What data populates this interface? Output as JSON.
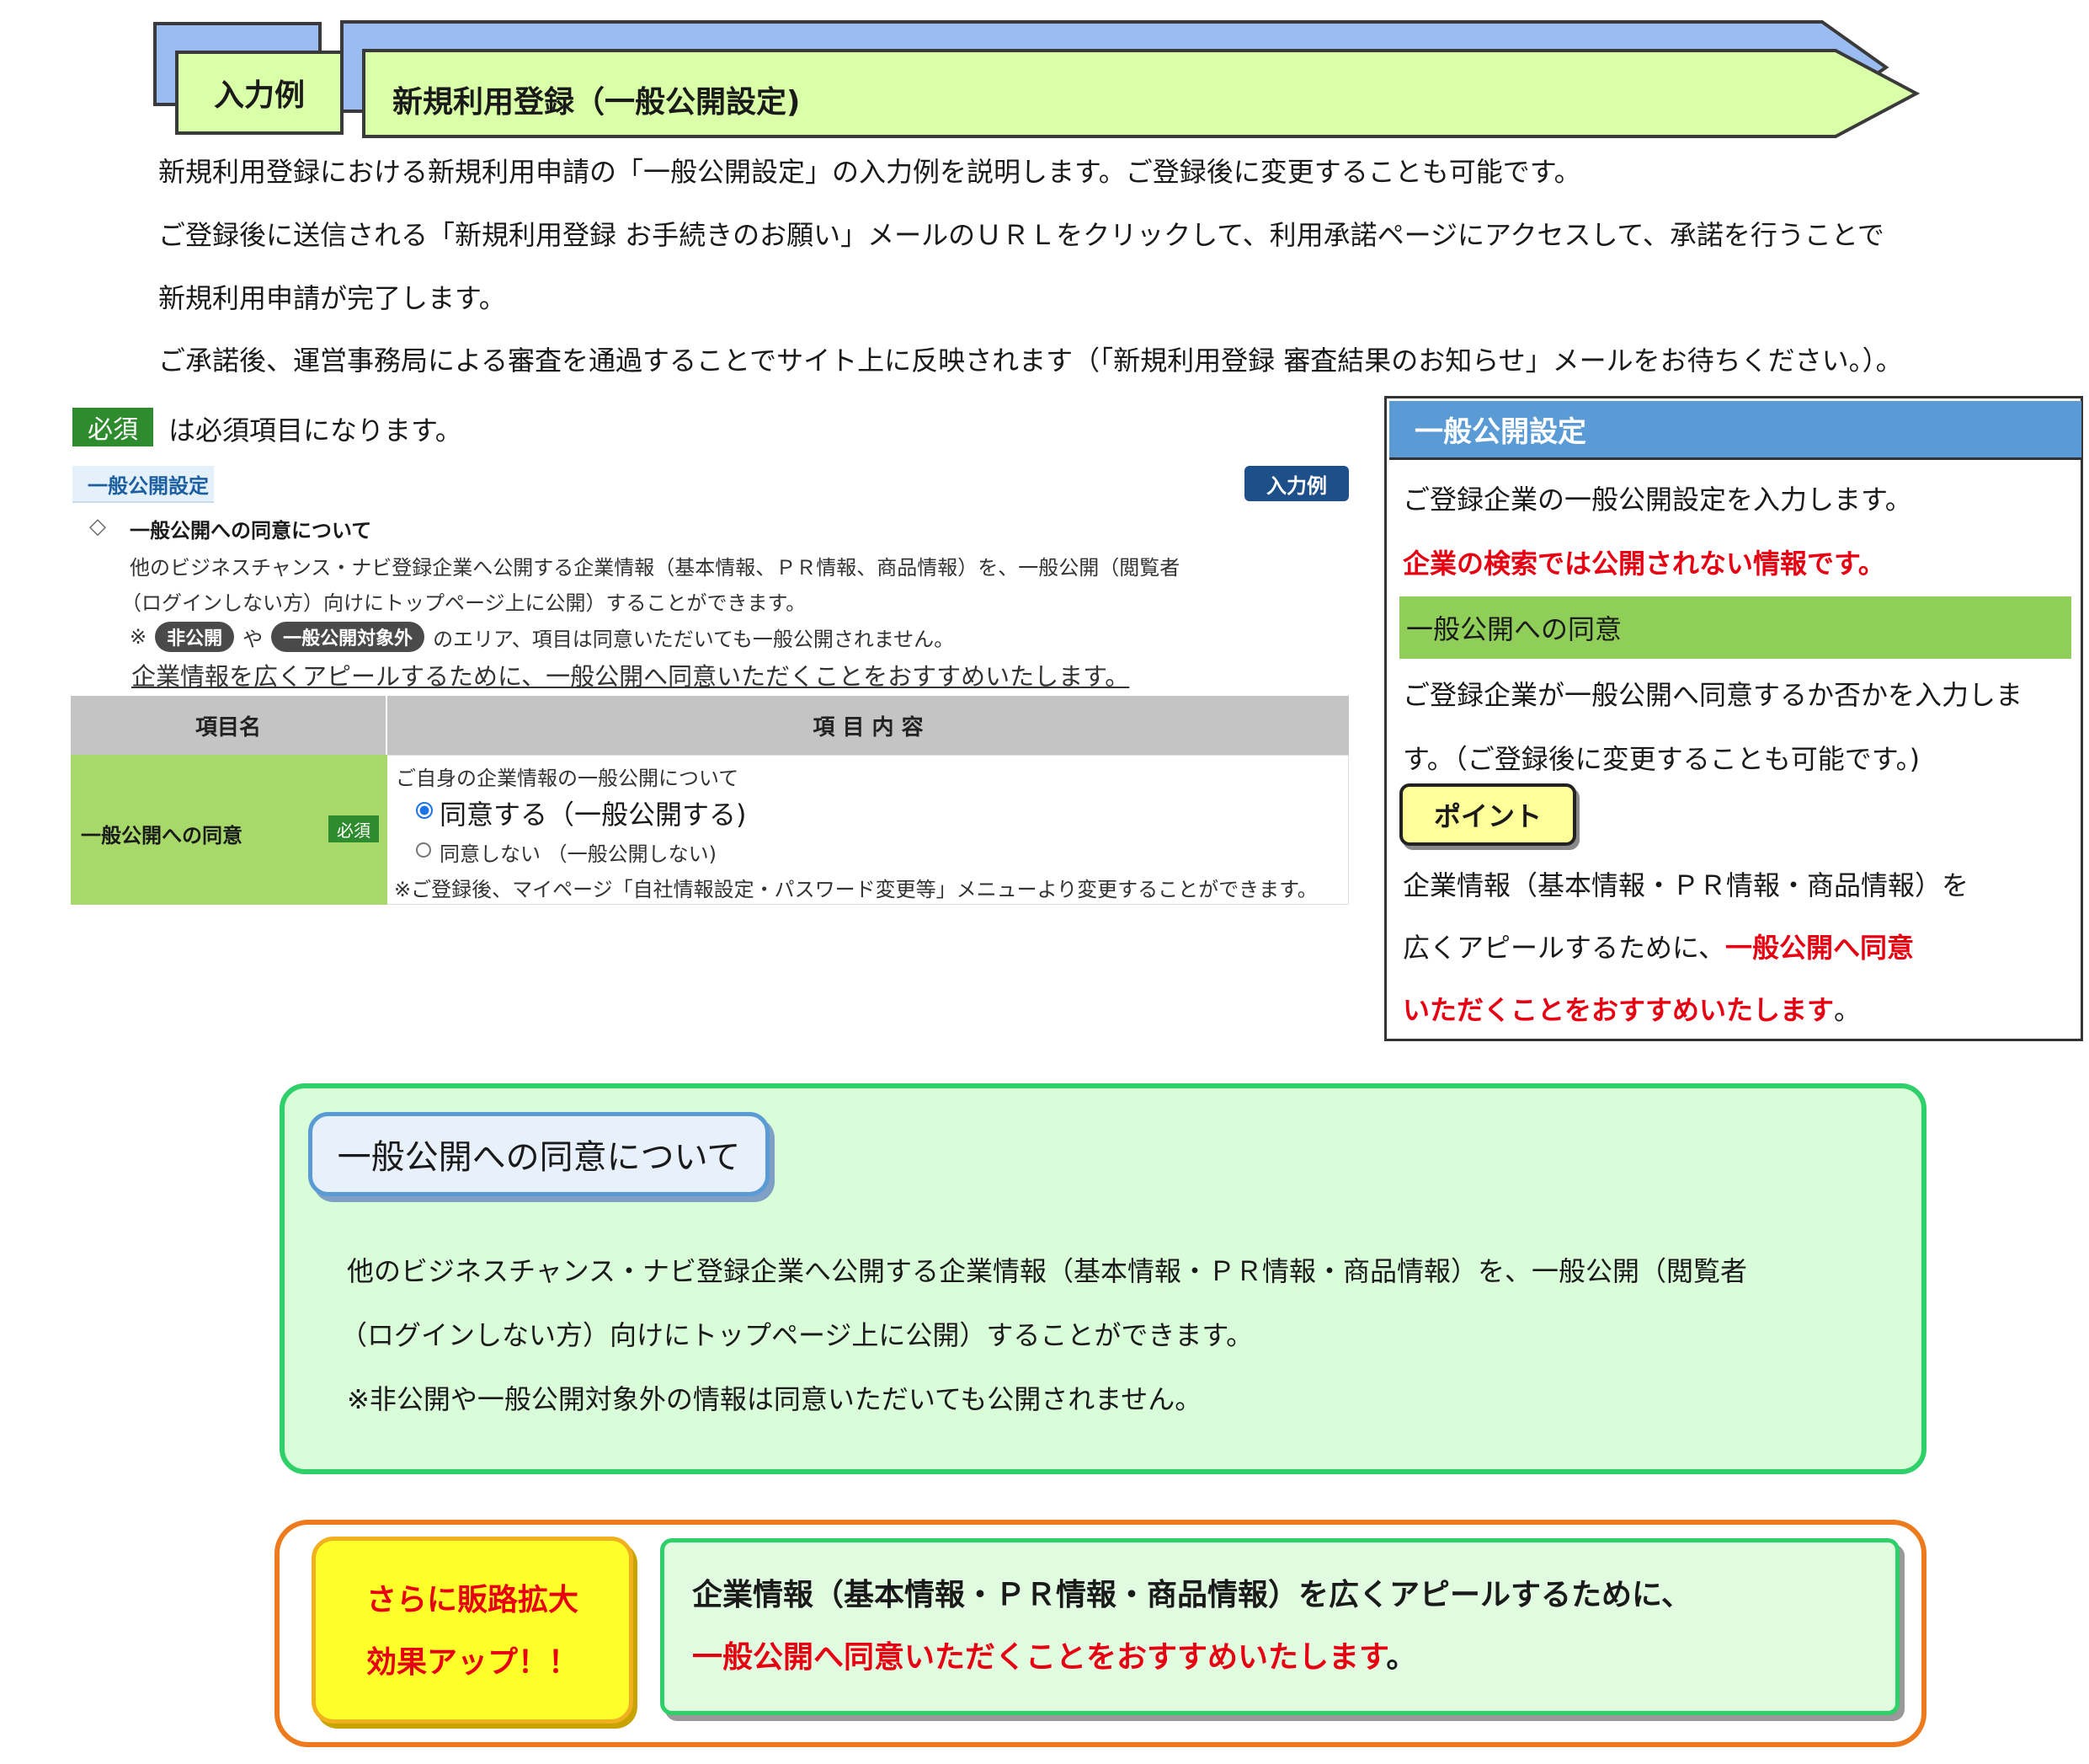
{
  "header": {
    "tag": "入力例",
    "title": "新規利用登録（一般公開設定)"
  },
  "intro": {
    "line1": "新規利用登録における新規利用申請の「一般公開設定」の入力例を説明します。ご登録後に変更することも可能です。",
    "line2": "ご登録後に送信される「新規利用登録 お手続きのお願い」メールのＵＲＬをクリックして、利用承諾ページにアクセスして、承諾を行うことで",
    "line3": "新規利用申請が完了します。",
    "line4": "ご承諾後、運営事務局による審査を通過することでサイト上に反映されます（「新規利用登録 審査結果のお知らせ」メールをお待ちください。）。"
  },
  "required_note": {
    "badge": "必須",
    "text": "は必須項目になります。"
  },
  "form": {
    "section_tab": "一般公開設定",
    "example_button": "入力例",
    "consent_heading": "一般公開への同意について",
    "desc1": "他のビジネスチャンス・ナビ登録企業へ公開する企業情報（基本情報、ＰＲ情報、商品情報）を、一般公開（閲覧者",
    "desc2": "（ログインしない方）向けにトップページ上に公開）することができます。",
    "note_prefix": "※",
    "pill1": "非公開",
    "note_mid": "や",
    "pill2": "一般公開対象外",
    "note_suffix": "のエリア、項目は同意いただいても一般公開されません。",
    "underline_text": "企業情報を広くアピールするために、一般公開へ同意いただくことをおすすめいたします。",
    "table": {
      "col_name": "項目名",
      "col_content": "項 目 内 容",
      "row_label": "一般公開への同意",
      "row_required": "必須",
      "row_caption": "ご自身の企業情報の一般公開について",
      "option_agree": "同意する（一般公開する)",
      "option_disagree": "同意しない （一般公開しない)",
      "footnote": "※ご登録後、マイページ「自社情報設定・パスワード変更等」メニューより変更することができます。"
    }
  },
  "side_panel": {
    "title": "一般公開設定",
    "line1": "ご登録企業の一般公開設定を入力します。",
    "line2_red": "企業の検索では公開されない情報です。",
    "bar_label": "一般公開への同意",
    "line3": "ご登録企業が一般公開へ同意するか否かを入力しま",
    "line4": "す。（ご登録後に変更することも可能です。)",
    "point": "ポイント",
    "line5": "企業情報（基本情報・ＰＲ情報・商品情報）を",
    "line6_plain": "広くアピールするために、",
    "line6_red": "一般公開へ同意",
    "line7_red": "いただくことをおすすめいたします",
    "line7_end": "。"
  },
  "info_box": {
    "tag": "一般公開への同意について",
    "line1": "他のビジネスチャンス・ナビ登録企業へ公開する企業情報（基本情報・ＰＲ情報・商品情報）を、一般公開（閲覧者",
    "line2": "（ログインしない方）向けにトップページ上に公開）することができます。",
    "line3": "※非公開や一般公開対象外の情報は同意いただいても公開されません。"
  },
  "promo": {
    "yellow_line1": "さらに販路拡大",
    "yellow_line2": "効果アップ！！",
    "mint_line1": "企業情報（基本情報・ＰＲ情報・商品情報）を広くアピールするために、",
    "mint_line2_red": "一般公開へ同意いただくことをおすすめいたします",
    "mint_line2_end": "。"
  },
  "colors": {
    "header_back": "#9bbcf0",
    "header_front": "#d9ffa8",
    "side_title": "#5b9bd5",
    "green_bar": "#8fce58",
    "info_border": "#2fd06a",
    "promo_border": "#ee7a1e",
    "emphasis_red": "#e60012"
  }
}
